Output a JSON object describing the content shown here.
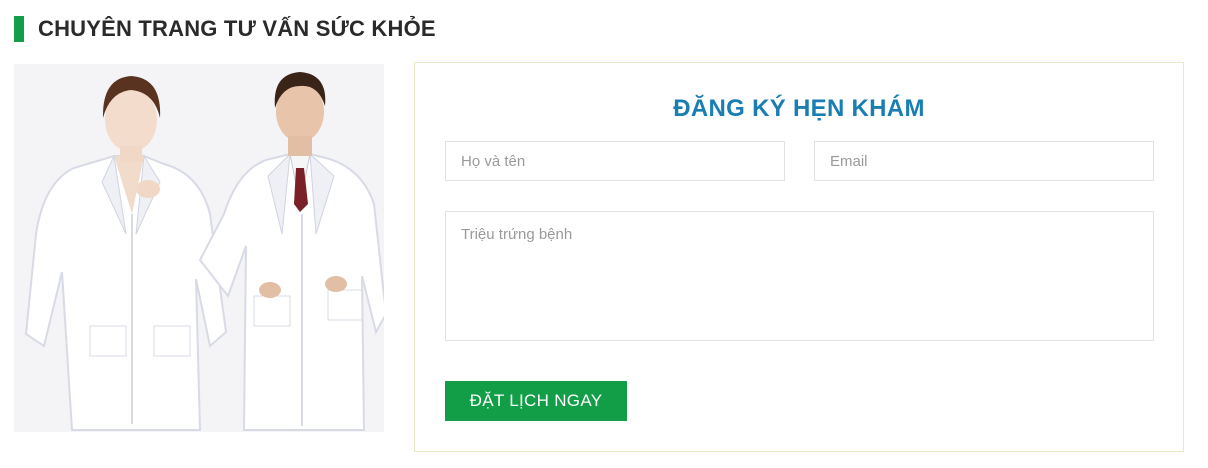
{
  "section": {
    "title": "CHUYÊN TRANG TƯ VẤN SỨC KHỎE"
  },
  "colors": {
    "brand_green": "#119e46",
    "title_blue": "#1a7eb3",
    "form_border": "#ebe7c9"
  },
  "form": {
    "title": "ĐĂNG KÝ HẸN KHÁM",
    "name_placeholder": "Họ và tên",
    "name_value": "",
    "email_placeholder": "Email",
    "email_value": "",
    "symptom_placeholder": "Triệu trứng bệnh",
    "symptom_value": "",
    "submit_label": "ĐẶT LỊCH NGAY"
  }
}
